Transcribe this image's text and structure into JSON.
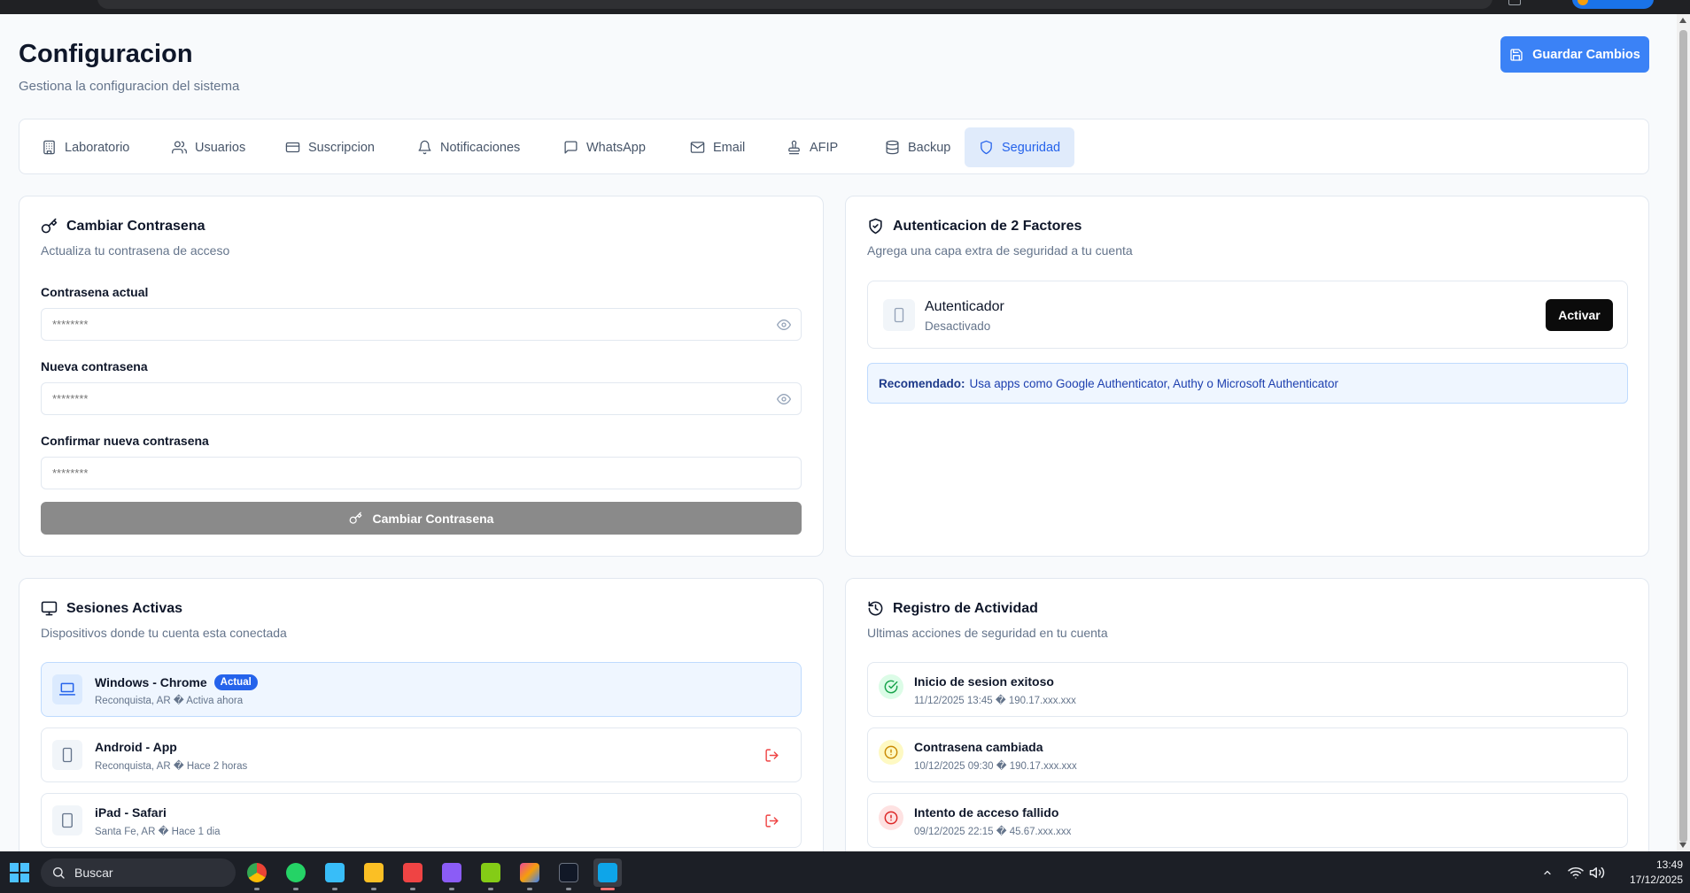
{
  "header": {
    "title": "Configuracion",
    "subtitle": "Gestiona la configuracion del sistema",
    "save_label": "Guardar Cambios"
  },
  "tabs": [
    {
      "label": "Laboratorio",
      "icon": "building-icon"
    },
    {
      "label": "Usuarios",
      "icon": "users-icon"
    },
    {
      "label": "Suscripcion",
      "icon": "credit-card-icon"
    },
    {
      "label": "Notificaciones",
      "icon": "bell-icon"
    },
    {
      "label": "WhatsApp",
      "icon": "chat-icon"
    },
    {
      "label": "Email",
      "icon": "mail-icon"
    },
    {
      "label": "AFIP",
      "icon": "stamp-icon"
    },
    {
      "label": "Backup",
      "icon": "database-icon"
    },
    {
      "label": "Seguridad",
      "icon": "shield-icon",
      "active": true
    }
  ],
  "password": {
    "title": "Cambiar Contrasena",
    "description": "Actualiza tu contrasena de acceso",
    "current_label": "Contrasena actual",
    "current_placeholder": "********",
    "new_label": "Nueva contrasena",
    "new_placeholder": "********",
    "confirm_label": "Confirmar nueva contrasena",
    "confirm_placeholder": "********",
    "button_label": "Cambiar Contrasena"
  },
  "two_factor": {
    "title": "Autenticacion de 2 Factores",
    "description": "Agrega una capa extra de seguridad a tu cuenta",
    "method_name": "Autenticador",
    "method_status": "Desactivado",
    "activate_label": "Activar",
    "recommend_prefix": "Recomendado:",
    "recommend_text": "Usa apps como Google Authenticator, Authy o Microsoft Authenticator"
  },
  "sessions": {
    "title": "Sesiones Activas",
    "description": "Dispositivos donde tu cuenta esta conectada",
    "items": [
      {
        "device": "Windows - Chrome",
        "detail": "Reconquista, AR � Activa ahora",
        "badge": "Actual",
        "icon": "laptop-icon"
      },
      {
        "device": "Android - App",
        "detail": "Reconquista, AR � Hace 2 horas",
        "icon": "smartphone-icon"
      },
      {
        "device": "iPad - Safari",
        "detail": "Santa Fe, AR � Hace 1 dia",
        "icon": "tablet-icon"
      }
    ]
  },
  "activity": {
    "title": "Registro de Actividad",
    "description": "Ultimas acciones de seguridad en tu cuenta",
    "items": [
      {
        "event": "Inicio de sesion exitoso",
        "detail": "11/12/2025 13:45 � 190.17.xxx.xxx",
        "status": "success",
        "color": "#16a34a",
        "bg": "#dcfce7"
      },
      {
        "event": "Contrasena cambiada",
        "detail": "10/12/2025 09:30 � 190.17.xxx.xxx",
        "status": "warning",
        "color": "#ca8a04",
        "bg": "#fef9c3"
      },
      {
        "event": "Intento de acceso fallido",
        "detail": "09/12/2025 22:15 � 45.67.xxx.xxx",
        "status": "error",
        "color": "#dc2626",
        "bg": "#fee2e2"
      }
    ]
  },
  "taskbar": {
    "search_placeholder": "Buscar",
    "time": "13:49",
    "date": "17/12/2025"
  },
  "colors": {
    "primary": "#3b82f6",
    "active_tab_bg": "#e0ebfb",
    "danger": "#ef4444"
  }
}
